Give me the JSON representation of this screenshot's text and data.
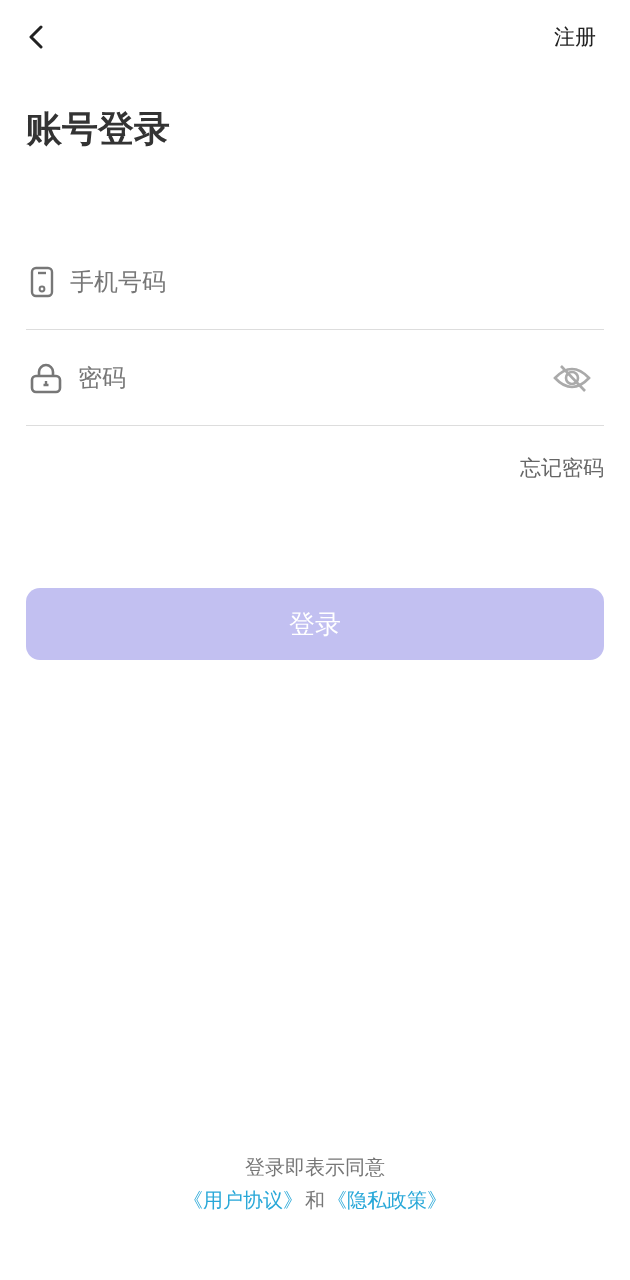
{
  "header": {
    "action": "注册"
  },
  "title": "账号登录",
  "fields": [
    {
      "kind": "phone",
      "placeholder": "手机号码"
    },
    {
      "kind": "password",
      "placeholder": "密码",
      "visible": false
    }
  ],
  "forgot_link": "忘记密码",
  "login_button": {
    "label": "登录",
    "disabled": true
  },
  "agreement": {
    "text": "登录即表示同意",
    "link_1": "《用户协议》",
    "joiner": "和",
    "link_2": "《隐私政策》"
  }
}
